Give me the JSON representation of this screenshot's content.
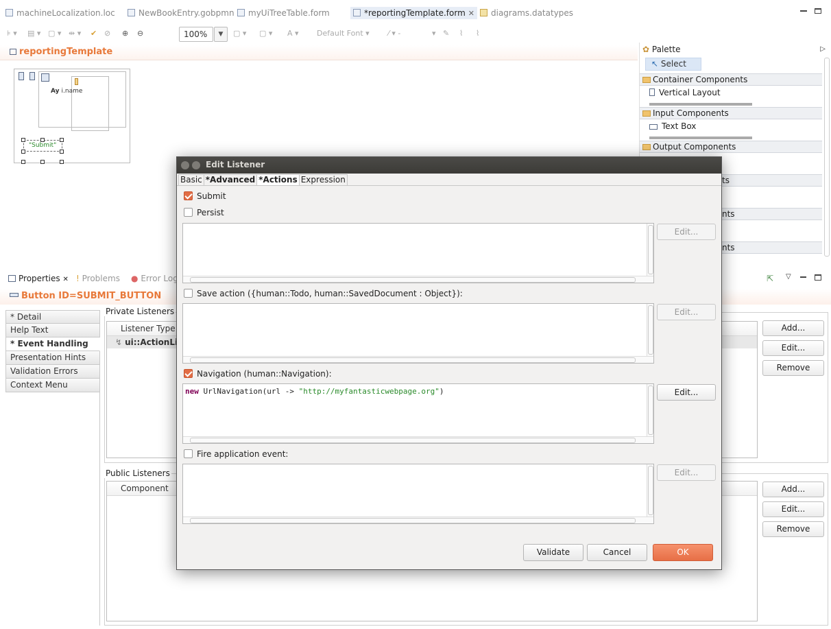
{
  "editor_tabs": [
    {
      "label": "machineLocalization.loc"
    },
    {
      "label": "NewBookEntry.gobpmn"
    },
    {
      "label": "myUiTreeTable.form"
    },
    {
      "label": "*reportingTemplate.form"
    },
    {
      "label": "diagrams.datatypes"
    }
  ],
  "toolbar": {
    "zoom": "100%",
    "font_label": "Default Font",
    "font_letter": "A"
  },
  "canvas": {
    "title": "reportingTemplate",
    "tree_label": "i.name",
    "ay": "Ay",
    "submit_label": "\"Submit\""
  },
  "palette": {
    "title": "Palette",
    "select": "Select",
    "categories": [
      {
        "label": "Container Components"
      },
      {
        "label": "Input Components"
      },
      {
        "label": "Output Components"
      }
    ],
    "items": [
      {
        "label": "Vertical Layout"
      },
      {
        "label": "Text Box"
      }
    ],
    "obscured": [
      "ts",
      "nts",
      "nts"
    ]
  },
  "props": {
    "tabs": [
      {
        "label": "Properties"
      },
      {
        "label": "Problems"
      },
      {
        "label": "Error Log"
      }
    ],
    "button_title": "Button ID=SUBMIT_BUTTON",
    "sections": [
      {
        "label": "* Detail"
      },
      {
        "label": "Help Text"
      },
      {
        "label": "* Event Handling"
      },
      {
        "label": "Presentation Hints"
      },
      {
        "label": "Validation Errors"
      },
      {
        "label": "Context Menu"
      }
    ],
    "private_listeners": {
      "title": "Private Listeners",
      "column": "Listener Type",
      "row": "ui::ActionLis"
    },
    "public_listeners": {
      "title": "Public Listeners",
      "column": "Component"
    },
    "buttons": {
      "add": "Add...",
      "edit": "Edit...",
      "remove": "Remove"
    }
  },
  "dialog": {
    "title": "Edit Listener",
    "tabs": [
      {
        "label": "Basic"
      },
      {
        "label": "*Advanced"
      },
      {
        "label": "*Actions"
      },
      {
        "label": "Expression"
      }
    ],
    "submit": {
      "label": "Submit",
      "checked": true
    },
    "persist": {
      "label": "Persist",
      "checked": false
    },
    "save_action": {
      "label": "Save action ({human::Todo, human::SavedDocument : Object}):",
      "checked": false
    },
    "navigation": {
      "label": "Navigation (human::Navigation):",
      "checked": true,
      "code_kw": "new",
      "code_mid": " UrlNavigation(url -> ",
      "code_str": "\"http://myfantasticwebpage.org\"",
      "code_end": ")"
    },
    "fire_event": {
      "label": "Fire application event:",
      "checked": false
    },
    "edit_label": "Edit...",
    "buttons": {
      "validate": "Validate",
      "cancel": "Cancel",
      "ok": "OK"
    }
  }
}
